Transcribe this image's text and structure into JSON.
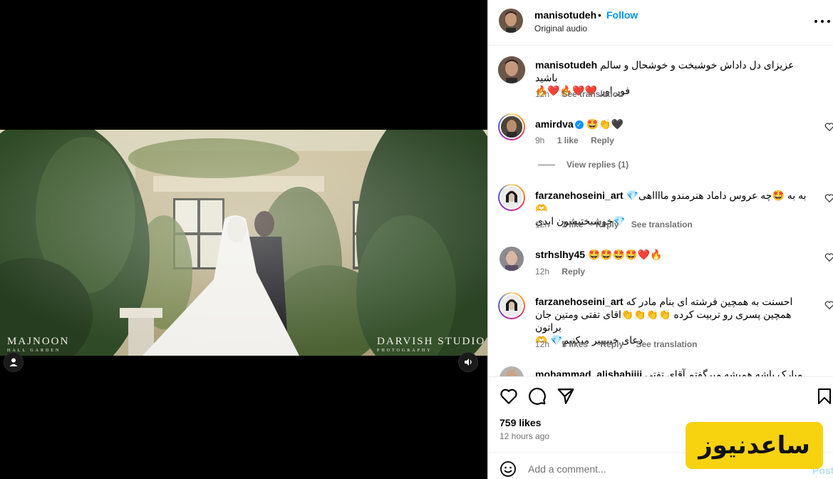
{
  "post": {
    "username": "manisotudeh",
    "separator": "•",
    "follow_label": "Follow",
    "audio": "Original audio",
    "more_icon": "more-horizontal-icon"
  },
  "media": {
    "watermark_left": {
      "title": "MAJNOON",
      "subtitle": "HALL GARDEN"
    },
    "watermark_right": {
      "title": "DARVISH STUDIO",
      "subtitle": "PHOTOGRAPHY"
    },
    "user_tag_icon": "user-icon",
    "mute_icon": "speaker-icon"
  },
  "caption": {
    "username": "manisotudeh",
    "text_line1": "عزیزای دل داداش خوشبخت و خوشحال و سالم باشید",
    "text_line2": "فور اور ❤️❤️🔥❤️🔥",
    "time": "12h",
    "see_translation": "See translation"
  },
  "comments": [
    {
      "username": "amirdva",
      "verified": true,
      "text": "🤩👏🖤",
      "time": "9h",
      "likes": "1 like",
      "reply": "Reply",
      "view_replies": "View replies (1)"
    },
    {
      "username": "farzanehoseini_art",
      "text_line1": "به به 🤩چه عروس داماد هنرمندو مااااهی💎 🫶",
      "text_line2": "💎خوشبختیشون ابدی",
      "time": "12h",
      "likes": "1 like",
      "reply": "Reply",
      "see_translation": "See translation"
    },
    {
      "username": "strhslhy45",
      "text": "🤩🤩🤩🤩❤️🔥",
      "time": "12h",
      "reply": "Reply"
    },
    {
      "username": "farzanehoseini_art",
      "text_line1": "احسنت به همچین فرشته ای بنام مادر که",
      "text_line2": "همچین پسری رو تربیت کرده 👏👏👏👏اقای تفتی ومتین جان براتون",
      "text_line3": "دعای خیییییر میکنیم💎 🫶",
      "time": "12h",
      "likes": "5 likes",
      "reply": "Reply",
      "see_translation": "See translation"
    },
    {
      "username": "mohammad_alishahiiii",
      "text": "مبارک باشه همیشه میرگفتم آقای تفتی"
    }
  ],
  "actions": {
    "like_icon": "heart-icon",
    "comment_icon": "comment-icon",
    "share_icon": "send-icon",
    "save_icon": "bookmark-icon",
    "likes": "759 likes",
    "time_ago": "12 hours ago"
  },
  "add_comment": {
    "emoji_icon": "emoji-icon",
    "placeholder": "Add a comment...",
    "post_label": "Post"
  },
  "watermark_badge": "ساعدنیوز",
  "colors": {
    "link": "#0095f6",
    "muted": "#737373",
    "badge": "#f7d20f",
    "post_disabled": "#b2dffc"
  }
}
